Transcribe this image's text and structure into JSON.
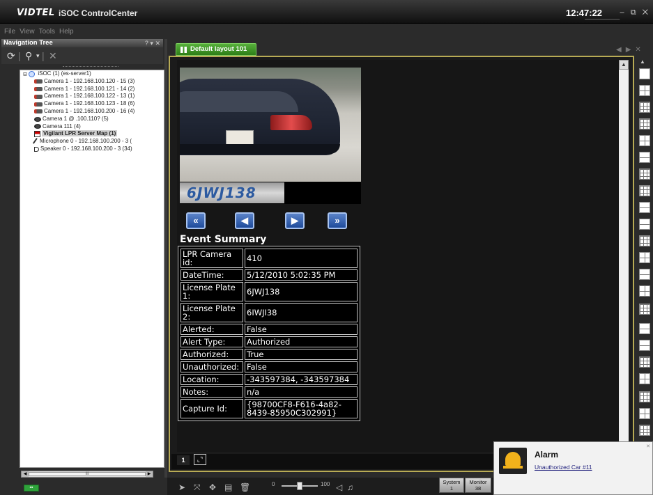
{
  "window": {
    "logo": "VIDTEL",
    "title": "iSOC ControlCenter",
    "clock": "12:47:22",
    "controls": "– ⧉ ✕"
  },
  "menu": [
    "File",
    "View",
    "Tools",
    "Help"
  ],
  "nav_panel": {
    "title": "Navigation Tree",
    "header_controls": "? ▾ ✕",
    "toolbar": [
      "refresh-icon",
      "filter-icon",
      "dropdown-icon",
      "delete-icon"
    ],
    "root": "iSOC (1) (es-server1)",
    "items": [
      {
        "label": "Camera 1 - 192.168.100.120 - 15 (3)",
        "icon": "camera-icon"
      },
      {
        "label": "Camera 1 - 192.168.100.121 - 14 (2)",
        "icon": "camera-icon"
      },
      {
        "label": "Camera 1 - 192.168.100.122 - 13 (1)",
        "icon": "camera-icon"
      },
      {
        "label": "Camera 1 - 192.168.100.123 - 18 (6)",
        "icon": "camera-icon"
      },
      {
        "label": "Camera 1 - 192.168.100.200 - 16 (4)",
        "icon": "camera-icon"
      },
      {
        "label": "Camera 1 @ .100.110? (5)",
        "icon": "dome-camera-icon"
      },
      {
        "label": "Camera 111 (4)",
        "icon": "dome-camera-icon"
      },
      {
        "label": "Vigilant LPR Server Map (1)",
        "icon": "map-icon"
      },
      {
        "label": "Microphone 0 - 192.168.100.200 - 3 (",
        "icon": "microphone-icon"
      },
      {
        "label": "Speaker 0 - 192.168.100.200 - 3 (34)",
        "icon": "speaker-icon"
      }
    ],
    "scroll_label": "III"
  },
  "layout": {
    "tab_label": "Default layout 101",
    "plate_text": "6JWJ138",
    "event_title": "Event Summary",
    "event_rows": [
      {
        "key": "LPR Camera id:",
        "value": "410"
      },
      {
        "key": "DateTime:",
        "value": "5/12/2010 5:02:35 PM"
      },
      {
        "key": "License Plate 1:",
        "value": "6JWJ138"
      },
      {
        "key": "License Plate 2:",
        "value": "6IWJI38"
      },
      {
        "key": "Alerted:",
        "value": "False"
      },
      {
        "key": "Alert Type:",
        "value": "Authorized"
      },
      {
        "key": "Authorized:",
        "value": "True"
      },
      {
        "key": "Unauthorized:",
        "value": "False"
      },
      {
        "key": "Location:",
        "value": "-343597384, -343597384"
      },
      {
        "key": "Notes:",
        "value": "n/a"
      },
      {
        "key": "Capture Id:",
        "value": "{98700CF8-F616-4a82-8439-85950C302991}"
      }
    ],
    "page_number": "1",
    "nav_buttons": [
      "first-icon",
      "previous-icon",
      "next-icon",
      "last-icon"
    ]
  },
  "bottom_bar": {
    "volume_min": "0",
    "volume_max": "100",
    "volume_level": 0.5,
    "system_label": "System",
    "system_count": "1",
    "monitor_label": "Monitor",
    "monitor_count": "38"
  },
  "alarm": {
    "title": "Alarm",
    "message": "Unauthorized Car #11",
    "close": "✕"
  },
  "colors": {
    "tab_green": "#3a9424",
    "layout_border": "#b8ab55",
    "nav_button_blue": "#2d5fb0",
    "alarm_bell": "#f2b21b"
  }
}
